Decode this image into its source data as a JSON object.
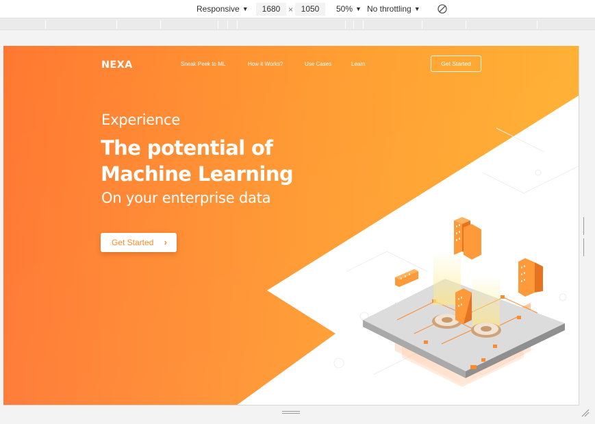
{
  "devtools": {
    "device": "Responsive",
    "width": "1680",
    "times": "×",
    "height": "1050",
    "zoom": "50%",
    "throttling": "No throttling",
    "caret": "▼"
  },
  "site": {
    "logo": "NEXA",
    "nav": [
      "Sneak Peek to ML",
      "How it Works?",
      "Use Cases",
      "Learn"
    ],
    "nav_cta": "Get Started",
    "eyebrow": "Experience",
    "headline_line1": "The potential of",
    "headline_line2": "Machine Learning",
    "subhead": "On your enterprise data",
    "hero_cta": "Get Started",
    "hero_cta_chevron": "›"
  },
  "colors": {
    "gradient_start": "#ff7a30",
    "gradient_end": "#ffac2e",
    "accent": "#ff8a2b",
    "platform": "#d9d9d9"
  }
}
